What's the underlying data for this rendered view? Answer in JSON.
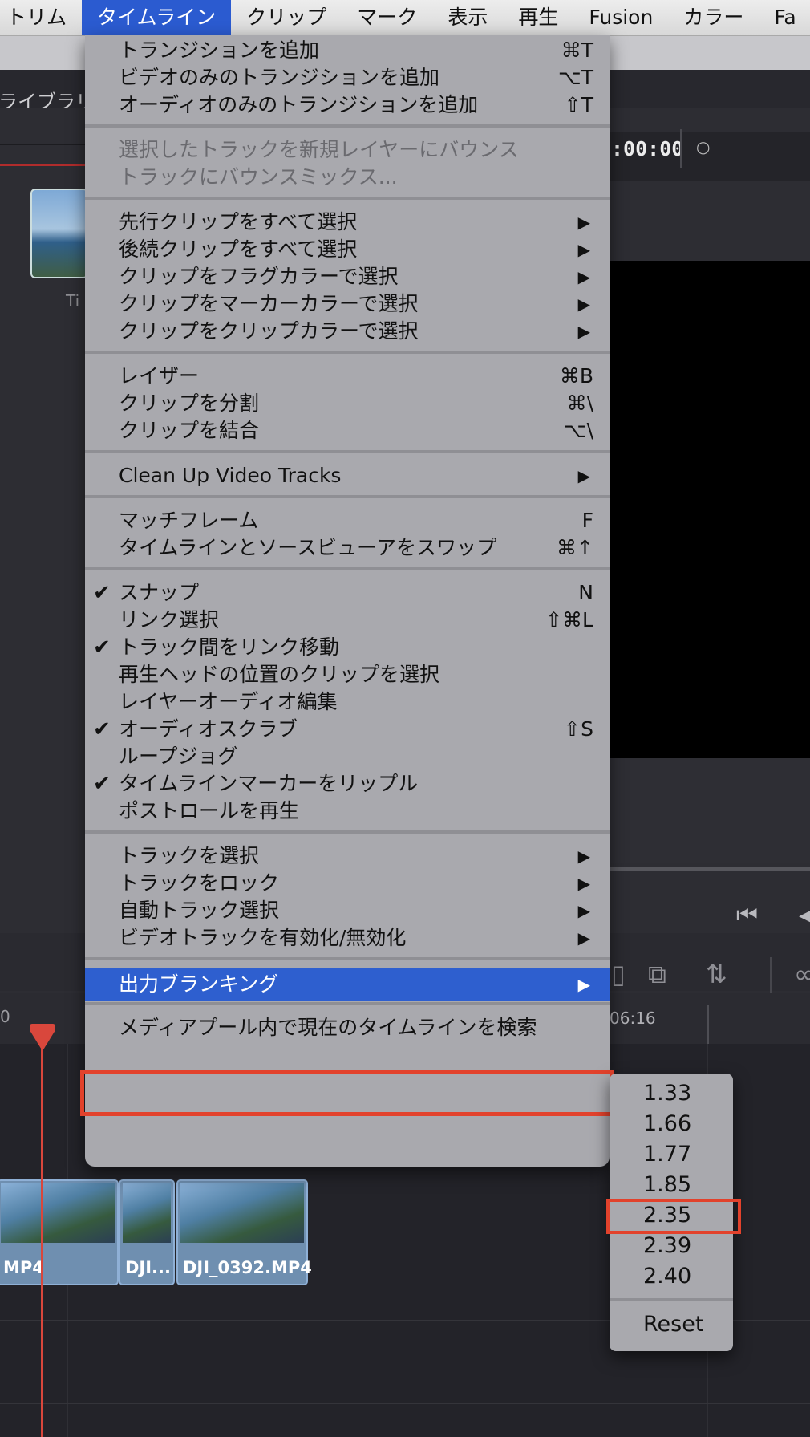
{
  "menubar": {
    "items": [
      "トリム",
      "タイムライン",
      "クリップ",
      "マーク",
      "表示",
      "再生",
      "Fusion",
      "カラー",
      "Fa"
    ],
    "active_index": 1
  },
  "background": {
    "library_label": "ライブラリ",
    "thumb_label": "Ti",
    "timecode": ":00:00",
    "ruler_start": "0",
    "ruler_mark": "06:16",
    "clips": [
      "MP4",
      "DJI...",
      "DJI_0392.MP4"
    ]
  },
  "timeline_menu": {
    "groups": [
      [
        {
          "label": "トランジションを追加",
          "shortcut": "⌘T"
        },
        {
          "label": "ビデオのみのトランジションを追加",
          "shortcut": "⌥T"
        },
        {
          "label": "オーディオのみのトランジションを追加",
          "shortcut": "⇧T"
        }
      ],
      [
        {
          "label": "選択したトラックを新規レイヤーにバウンス",
          "disabled": true
        },
        {
          "label": "トラックにバウンスミックス...",
          "disabled": true
        }
      ],
      [
        {
          "label": "先行クリップをすべて選択",
          "submenu": true
        },
        {
          "label": "後続クリップをすべて選択",
          "submenu": true
        },
        {
          "label": "クリップをフラグカラーで選択",
          "submenu": true
        },
        {
          "label": "クリップをマーカーカラーで選択",
          "submenu": true
        },
        {
          "label": "クリップをクリップカラーで選択",
          "submenu": true
        }
      ],
      [
        {
          "label": "レイザー",
          "shortcut": "⌘B"
        },
        {
          "label": "クリップを分割",
          "shortcut": "⌘\\"
        },
        {
          "label": "クリップを結合",
          "shortcut": "⌥\\"
        }
      ],
      [
        {
          "label": "Clean Up Video Tracks",
          "submenu": true
        }
      ],
      [
        {
          "label": "マッチフレーム",
          "shortcut": "F"
        },
        {
          "label": "タイムラインとソースビューアをスワップ",
          "shortcut": "⌘↑"
        }
      ],
      [
        {
          "label": "スナップ",
          "shortcut": "N",
          "checked": true
        },
        {
          "label": "リンク選択",
          "shortcut": "⇧⌘L"
        },
        {
          "label": "トラック間をリンク移動",
          "checked": true
        },
        {
          "label": "再生ヘッドの位置のクリップを選択"
        },
        {
          "label": "レイヤーオーディオ編集"
        },
        {
          "label": "オーディオスクラブ",
          "shortcut": "⇧S",
          "checked": true
        },
        {
          "label": "ループジョグ"
        },
        {
          "label": "タイムラインマーカーをリップル",
          "checked": true
        },
        {
          "label": "ポストロールを再生"
        }
      ],
      [
        {
          "label": "トラックを選択",
          "submenu": true
        },
        {
          "label": "トラックをロック",
          "submenu": true
        },
        {
          "label": "自動トラック選択",
          "submenu": true
        },
        {
          "label": "ビデオトラックを有効化/無効化",
          "submenu": true
        }
      ],
      [
        {
          "label": "出力ブランキング",
          "submenu": true,
          "highlighted": true
        }
      ],
      [
        {
          "label": "メディアプール内で現在のタイムラインを検索"
        }
      ]
    ]
  },
  "blanking_submenu": {
    "ratios": [
      "1.33",
      "1.66",
      "1.77",
      "1.85",
      "2.35",
      "2.39",
      "2.40"
    ],
    "reset_label": "Reset",
    "outlined_value": "2.35"
  },
  "symbols": {
    "check": "✔",
    "submenu_arrow": "▶"
  },
  "colors": {
    "highlight": "#2e5fcf",
    "outline": "#e2422c",
    "menu_bg": "#a9a9ae",
    "playhead": "#d9473c"
  }
}
